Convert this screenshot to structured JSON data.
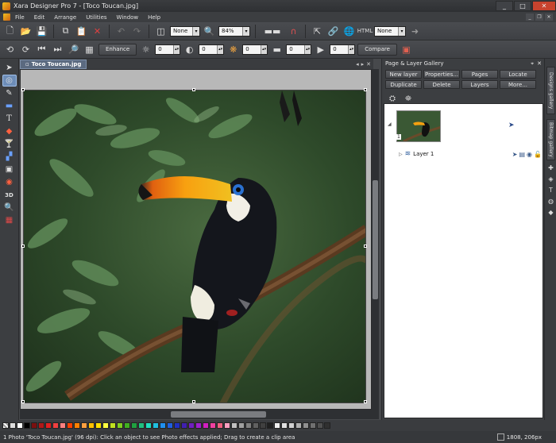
{
  "window": {
    "title": "Xara Designer Pro 7 - [Toco Toucan.jpg]",
    "minimize": "_",
    "maximize": "□",
    "close": "✕"
  },
  "menu": [
    "File",
    "Edit",
    "Arrange",
    "Utilities",
    "Window",
    "Help"
  ],
  "toolbar1": {
    "quality_select": "None",
    "zoom_value": "84%",
    "snap_select": "None"
  },
  "toolbar2": {
    "enhance_label": "Enhance",
    "brightness": "0",
    "contrast": "0",
    "saturation": "0",
    "temperature": "0",
    "sharpness": "0",
    "compare_label": "Compare"
  },
  "document": {
    "tab_label": "Toco Toucan.jpg"
  },
  "gallery": {
    "title": "Page & Layer Gallery",
    "buttons": [
      "New layer",
      "Properties...",
      "Pages",
      "Locate",
      "Duplicate",
      "Delete",
      "Layers",
      "More..."
    ],
    "page_number": "1",
    "layer_name": "Layer 1"
  },
  "right_tabs": {
    "designs": "Designs gallery",
    "bitmap": "Bitmap gallery"
  },
  "colors": {
    "accent": "#6d8db8",
    "chrome": "#3c3e41",
    "close": "#c8432e"
  },
  "palette": [
    "#ffffff",
    "#000000",
    "#7a1010",
    "#b01818",
    "#e02020",
    "#f04040",
    "#ff8080",
    "#ff4000",
    "#ff8000",
    "#ffa040",
    "#ffc000",
    "#ffe000",
    "#ffff40",
    "#c0e020",
    "#80d020",
    "#40b020",
    "#20a040",
    "#20c080",
    "#20e0c0",
    "#20c0e0",
    "#2090f0",
    "#2060e0",
    "#2030c0",
    "#4020b0",
    "#7020c0",
    "#a020d0",
    "#d020c0",
    "#f040a0",
    "#f06080",
    "#ffa0c0",
    "#c0c0c0",
    "#a0a0a0",
    "#808080",
    "#606060",
    "#404040",
    "#202020",
    "#f0f0f0",
    "#e0e0e0",
    "#d0d0d0",
    "#b0b0b0",
    "#909090",
    "#707070",
    "#505050",
    "#303030"
  ],
  "status": {
    "message": "1 Photo 'Toco Toucan.jpg' (96 dpi): Click an object to see Photo effects applied; Drag to create a clip area",
    "coords": "1808, 206px"
  }
}
